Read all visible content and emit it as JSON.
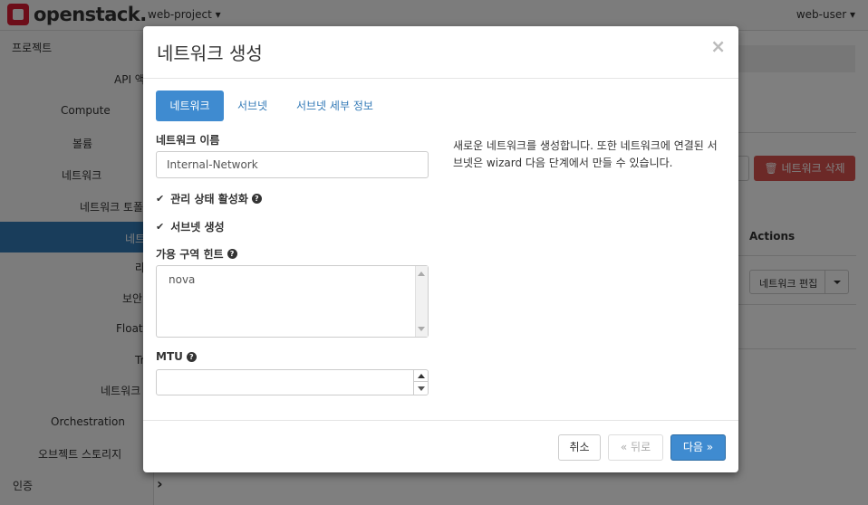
{
  "topbar": {
    "brand": "openstack.",
    "project": "web-project ▾",
    "user": "web-user ▾"
  },
  "sidebar": {
    "items": [
      "프로젝트",
      "API 액",
      "Compute",
      "볼륨",
      "네트워크",
      "네트워크 토폴",
      "네트",
      "라",
      "보안",
      "Floati",
      "Tr",
      "네트워크",
      "Orchestration",
      "오브젝트 스토리지",
      "인증"
    ],
    "auth_chevron": "›"
  },
  "background": {
    "delete_button": "🗑 네트워크 삭제",
    "actions_header": "Actions",
    "edit_button": "네트워크 편집"
  },
  "modal": {
    "title": "네트워크 생성",
    "close": "×",
    "tabs": [
      "네트워크",
      "서브넷",
      "서브넷 세부 정보"
    ],
    "network_name_label": "네트워크 이름",
    "network_name_value": "Internal-Network",
    "admin_state_label": "관리 상태 활성화",
    "create_subnet_label": "서브넷 생성",
    "az_hint_label": "가용 구역 힌트",
    "az_hint_value": "nova",
    "mtu_label": "MTU",
    "help_text": "새로운 네트워크를 생성합니다. 또한 네트워크에 연결된 서브넷은 wizard 다음 단계에서 만들 수 있습니다.",
    "buttons": {
      "cancel": "취소",
      "back": "« 뒤로",
      "next": "다음 »"
    }
  },
  "colors": {
    "primary": "#3f8bd0",
    "danger": "#d9534f",
    "sidebar_active": "#337ab7",
    "brand_red": "#da1a32"
  }
}
